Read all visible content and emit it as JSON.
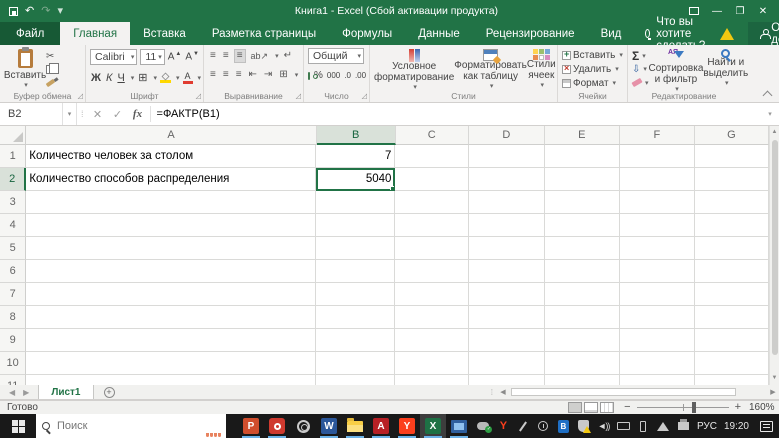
{
  "title_bar": {
    "title": "Книга1 - Excel (Сбой активации продукта)",
    "quick_access_icons": [
      "save-icon",
      "undo-icon",
      "redo-icon",
      "customize-quick-access-icon"
    ],
    "window_control_icons": [
      "ribbon-display-options-icon",
      "minimize-icon",
      "restore-icon",
      "close-icon"
    ]
  },
  "tabs": {
    "file": "Файл",
    "items": [
      "Главная",
      "Вставка",
      "Разметка страницы",
      "Формулы",
      "Данные",
      "Рецензирование",
      "Вид"
    ],
    "active": "Главная",
    "tell_me": "Что вы хотите сделать?",
    "share_label": "Общий доступ"
  },
  "ribbon": {
    "clipboard": {
      "paste": "Вставить",
      "group": "Буфер обмена",
      "icons": [
        "cut-icon",
        "copy-icon",
        "format-painter-icon"
      ]
    },
    "font": {
      "name": "Calibri",
      "size": "11",
      "bold": "Ж",
      "italic": "К",
      "underline": "Ч",
      "group": "Шрифт",
      "icons": [
        "grow-font-icon",
        "shrink-font-icon",
        "borders-icon",
        "fill-color-icon",
        "font-color-icon"
      ]
    },
    "alignment": {
      "group": "Выравнивание",
      "rotate": "ab",
      "icons": [
        "align-top-icon",
        "align-middle-icon",
        "align-bottom-icon",
        "orientation-icon",
        "wrap-text-icon",
        "align-left-icon",
        "align-center-icon",
        "align-right-icon",
        "decrease-indent-icon",
        "increase-indent-icon",
        "merge-center-icon"
      ]
    },
    "number": {
      "format": "Общий",
      "percent": "%",
      "thousands": "000",
      "inc_decimal": ".0",
      "dec_decimal": ".00",
      "group": "Число"
    },
    "styles": {
      "conditional": "Условное форматирование",
      "format_table": "Форматировать как таблицу",
      "cell_styles": "Стили ячеек",
      "group": "Стили"
    },
    "cells": {
      "insert": "Вставить",
      "delete": "Удалить",
      "format": "Формат",
      "group": "Ячейки"
    },
    "editing": {
      "autosum": "Σ",
      "sort_filter": "Сортировка и фильтр",
      "find_select": "Найти и выделить",
      "group": "Редактирование",
      "sort_letters": "АЯ"
    }
  },
  "formula_bar": {
    "name_box": "B2",
    "formula": "=ФАКТР(B1)",
    "icons": [
      "cancel-icon",
      "enter-icon",
      "insert-function-icon"
    ]
  },
  "grid": {
    "columns": [
      "A",
      "B",
      "C",
      "D",
      "E",
      "F",
      "G"
    ],
    "rows": [
      "1",
      "2",
      "3",
      "4",
      "5",
      "6",
      "7",
      "8",
      "9",
      "10",
      "11"
    ],
    "selected_column": "B",
    "selected_row": "2",
    "selected_cell": "B2",
    "cells": {
      "A1": "Количество человек за столом",
      "B1": "7",
      "A2": "Количество способов распределения",
      "B2": "5040"
    }
  },
  "sheet_bar": {
    "sheet_name": "Лист1",
    "icons": [
      "sheet-prev-icon",
      "sheet-next-icon",
      "new-sheet-icon"
    ]
  },
  "status_bar": {
    "mode": "Готово",
    "zoom_level": "160%",
    "view_icons": [
      "normal-view-icon",
      "page-layout-view-icon",
      "page-break-view-icon"
    ]
  },
  "taskbar": {
    "search_placeholder": "Поиск",
    "language": "РУС",
    "time": "19:20",
    "apps": [
      {
        "name": "powerpoint-icon",
        "kind": "letter",
        "glyph": "P",
        "color": "#d04e2d",
        "running": true
      },
      {
        "name": "camera-icon",
        "kind": "camera",
        "running": true
      },
      {
        "name": "settings-gear-icon",
        "kind": "gear",
        "running": false
      },
      {
        "name": "word-icon",
        "kind": "letter",
        "glyph": "W",
        "color": "#2b579a",
        "running": true
      },
      {
        "name": "file-explorer-icon",
        "kind": "folder",
        "running": true
      },
      {
        "name": "acrobat-icon",
        "kind": "letter",
        "glyph": "A",
        "color": "#b72025",
        "running": true
      },
      {
        "name": "yandex-browser-icon",
        "kind": "letter",
        "glyph": "Y",
        "color": "#fc3f1d",
        "running": true
      },
      {
        "name": "excel-icon",
        "kind": "excel",
        "glyph": "X",
        "running": true,
        "active": true
      },
      {
        "name": "display-settings-icon",
        "kind": "display",
        "running": true
      }
    ],
    "tray_icons": [
      "cloud-sync-icon",
      "yandex-tray-icon",
      "pen-icon",
      "clock-icon",
      "bluetooth-icon",
      "security-shield-icon",
      "volume-icon",
      "keyboard-icon",
      "phone-icon",
      "network-signal-icon",
      "printer-icon"
    ]
  },
  "colors": {
    "excel_green": "#217346",
    "selection_green": "#217346",
    "warning_yellow": "#f2c811",
    "taskbar_underline": "#6cb2e8"
  }
}
